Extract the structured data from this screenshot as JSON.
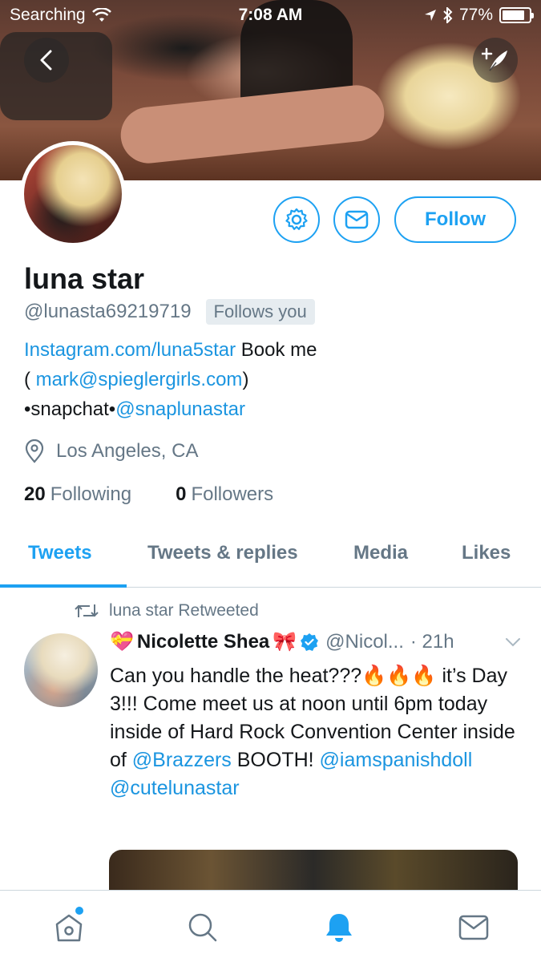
{
  "status_bar": {
    "carrier": "Searching",
    "time": "7:08 AM",
    "battery": "77%"
  },
  "header": {
    "back_icon": "chevron-left-icon",
    "compose_icon": "compose-tweet-icon"
  },
  "profile": {
    "name": "luna star",
    "handle": "@lunasta69219719",
    "follows_you": "Follows you",
    "bio": {
      "link1": "Instagram.com/luna5star",
      "text1": " Book me",
      "text2": "( ",
      "email": "mark@spieglergirls.com",
      "text3": ")",
      "text4": "•snapchat•",
      "snap_handle": "@snaplunastar"
    },
    "location": "Los Angeles, CA",
    "following_count": "20",
    "following_label": "Following",
    "followers_count": "0",
    "followers_label": "Followers",
    "follow_button": "Follow"
  },
  "tabs": [
    {
      "label": "Tweets",
      "active": true
    },
    {
      "label": "Tweets & replies",
      "active": false
    },
    {
      "label": "Media",
      "active": false
    },
    {
      "label": "Likes",
      "active": false
    }
  ],
  "tweet": {
    "retweeted_by": "luna star Retweeted",
    "author_name": "Nicolette Shea",
    "author_prefix_emoji": "💝",
    "author_suffix_emoji": "🎀",
    "author_handle": "@Nicol...",
    "time": "· 21h",
    "text": {
      "p1": "Can you handle the heat???🔥🔥🔥 it’s Day 3!!! Come meet us at noon until 6pm today inside of Hard Rock Convention Center inside of ",
      "mention1": "@Brazzers",
      "p2": " BOOTH! ",
      "mention2": "@iamspanishdoll",
      "p3": " ",
      "mention3": "@cutelunastar"
    }
  },
  "bottom_nav": {
    "items": [
      "home-icon",
      "search-icon",
      "notifications-icon",
      "messages-icon"
    ],
    "active": "notifications-icon"
  },
  "colors": {
    "accent": "#1da1f2",
    "text": "#14171a",
    "secondary_text": "#657786",
    "link": "#1b95e0"
  }
}
